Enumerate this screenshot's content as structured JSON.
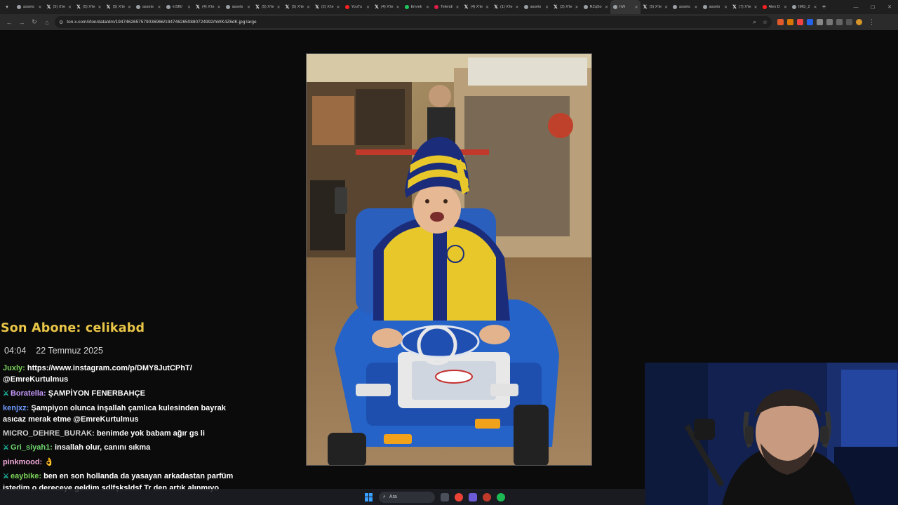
{
  "browser": {
    "tabs": [
      {
        "label": "assets",
        "icon": "globe-icon"
      },
      {
        "label": "(5) X'te",
        "icon": "x-logo-icon"
      },
      {
        "label": "(5) X'te",
        "icon": "x-logo-icon"
      },
      {
        "label": "(5) X'te",
        "icon": "x-logo-icon"
      },
      {
        "label": "assets",
        "icon": "globe-icon"
      },
      {
        "label": "mSf0/",
        "icon": "globe-icon"
      },
      {
        "label": "(4) X'te",
        "icon": "x-logo-icon"
      },
      {
        "label": "assets",
        "icon": "globe-icon"
      },
      {
        "label": "(5) X'te",
        "icon": "x-logo-icon"
      },
      {
        "label": "(5) X'te",
        "icon": "x-logo-icon"
      },
      {
        "label": "(2) X'te",
        "icon": "x-logo-icon"
      },
      {
        "label": "YouTu",
        "icon": "youtube-icon"
      },
      {
        "label": "(4) X'te",
        "icon": "x-logo-icon"
      },
      {
        "label": "Emrek",
        "icon": "green-icon"
      },
      {
        "label": "Telendi",
        "icon": "pink-icon"
      },
      {
        "label": "(4) X'te",
        "icon": "x-logo-icon"
      },
      {
        "label": "(1) X'te",
        "icon": "x-logo-icon"
      },
      {
        "label": "assets",
        "icon": "globe-icon"
      },
      {
        "label": "(3) X'te",
        "icon": "x-logo-icon"
      },
      {
        "label": "RZqSo",
        "icon": "globe-icon"
      },
      {
        "label": "hW",
        "icon": "globe-icon",
        "active": true
      },
      {
        "label": "(5) X'te",
        "icon": "x-logo-icon"
      },
      {
        "label": "assets",
        "icon": "globe-icon"
      },
      {
        "label": "assets",
        "icon": "globe-icon"
      },
      {
        "label": "(7) X'te",
        "icon": "x-logo-icon"
      },
      {
        "label": "Alex D",
        "icon": "youtube-icon"
      },
      {
        "label": "IMG_2",
        "icon": "globe-icon"
      }
    ],
    "url": "ton.x.com/i/ton/data/dm/1947462657579036966/1947462650880724992/hWK4Z6dK.jpg:large"
  },
  "chat": {
    "last_sub": "Son Abone: celikabd",
    "time": "04:04",
    "date": "22 Temmuz 2025",
    "messages": [
      {
        "user": "Juxly:",
        "color": "#7bd35a",
        "badge": false,
        "text": "https://www.instagram.com/p/DMY8JutCPhT/ @EmreKurtulmus"
      },
      {
        "user": "Boratella:",
        "color": "#c79bff",
        "badge": true,
        "text": "ŞAMPİYON FENERBAHÇE"
      },
      {
        "user": "kenjxz:",
        "color": "#6f9cff",
        "badge": false,
        "text": "Şampiyon olunca inşallah çamlıca kulesinden bayrak asıcaz merak etme @EmreKurtulmus"
      },
      {
        "user": "MICRO_DEHRE_BURAK:",
        "color": "#cfcfcf",
        "badge": false,
        "text": "benimde yok babam ağır gs li"
      },
      {
        "user": "Gri_siyah1:",
        "color": "#6fd66f",
        "badge": true,
        "text": "insallah olur, canını sıkma"
      },
      {
        "user": "pinkmood:",
        "color": "#f0a8d8",
        "badge": false,
        "text": "👌"
      },
      {
        "user": "eaybike:",
        "color": "#7bd35a",
        "badge": true,
        "text": "ben en son hollanda da yasayan arkadastan parfüm istedim o dereceye geldim sdlfşksldsf Tr den artık alınmıyo"
      }
    ]
  },
  "taskbar": {
    "search_placeholder": "Ara"
  }
}
